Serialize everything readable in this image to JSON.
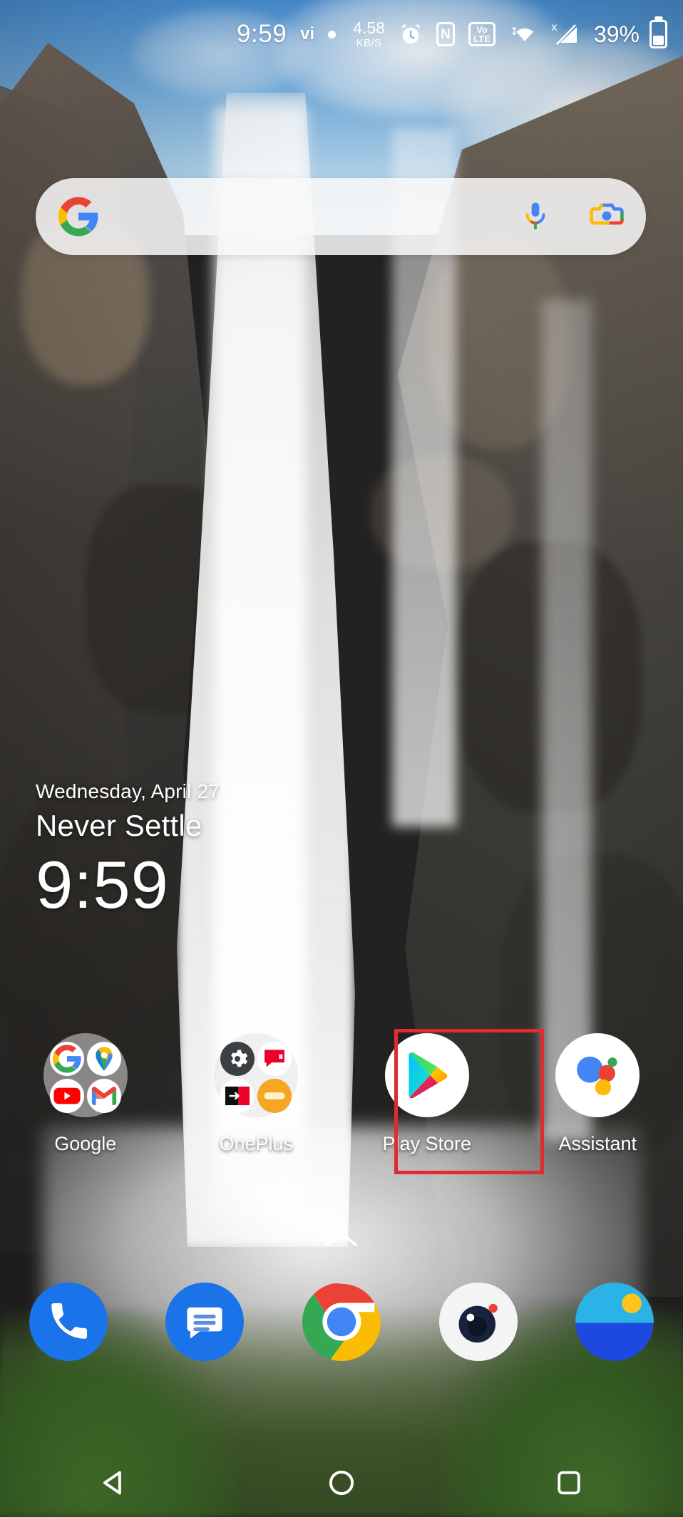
{
  "device": {
    "platform": "android",
    "screen": "home-screen"
  },
  "status_bar": {
    "clock": "9:59",
    "carrier_glyph": "vi",
    "notification_dot": "●",
    "network_speed": {
      "value": "4.58",
      "unit": "KB/S"
    },
    "alarm_icon": "alarm-clock-icon",
    "nfc_label": "N",
    "volte_top": "Vo",
    "volte_bottom": "LTE",
    "wifi_icon": "wifi-icon",
    "signal_icon": "cellular-signal-no-sim-icon",
    "signal_superscript": "x",
    "battery_percent": "39%",
    "battery_level": 39
  },
  "search": {
    "google_logo": "google-g-logo",
    "placeholder": "",
    "value": "",
    "mic_icon": "microphone-icon",
    "lens_icon": "google-lens-camera-icon"
  },
  "clock_widget": {
    "date": "Wednesday, April 27",
    "tagline": "Never Settle",
    "time": "9:59"
  },
  "app_row": [
    {
      "label": "Google",
      "type": "folder",
      "icon": "google-folder-icon",
      "contents": [
        "google-search-icon",
        "google-maps-icon",
        "youtube-icon",
        "gmail-icon"
      ]
    },
    {
      "label": "OnePlus",
      "type": "folder",
      "icon": "oneplus-folder-icon",
      "contents": [
        "settings-gear-icon",
        "oneplus-community-icon",
        "oneplus-switch-icon",
        "zen-mode-icon"
      ]
    },
    {
      "label": "Play Store",
      "type": "app",
      "icon": "google-play-store-icon",
      "highlighted": true
    },
    {
      "label": "Assistant",
      "type": "app",
      "icon": "google-assistant-icon",
      "highlighted": false
    }
  ],
  "drawer_handle": {
    "icon": "chevron-up-icon"
  },
  "dock": [
    {
      "label": "Phone",
      "icon": "phone-icon"
    },
    {
      "label": "Messages",
      "icon": "messages-icon"
    },
    {
      "label": "Chrome",
      "icon": "chrome-icon"
    },
    {
      "label": "Camera",
      "icon": "camera-icon"
    },
    {
      "label": "Gallery",
      "icon": "gallery-icon"
    }
  ],
  "nav_bar": [
    {
      "label": "Back",
      "icon": "back-triangle-icon"
    },
    {
      "label": "Home",
      "icon": "home-circle-icon"
    },
    {
      "label": "Recents",
      "icon": "recents-square-icon"
    }
  ],
  "annotation": {
    "highlight_color": "#e02b31",
    "highlight_target": "Play Store"
  },
  "colors": {
    "google_blue": "#4285F4",
    "google_red": "#EA4335",
    "google_yellow": "#FBBC05",
    "google_green": "#34A853",
    "dock_blue": "#1a73e8",
    "highlight_red": "#e02b31"
  }
}
